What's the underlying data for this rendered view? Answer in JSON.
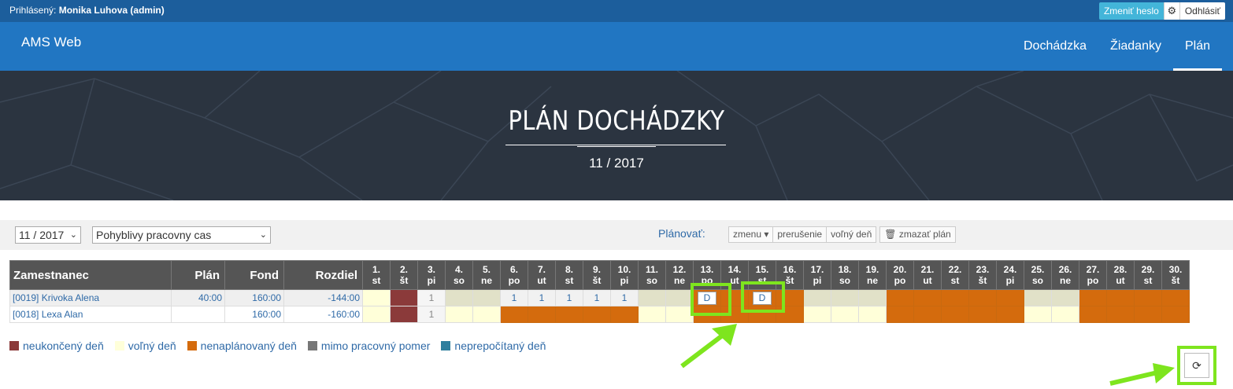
{
  "userbar": {
    "prefix": "Prihlásený:",
    "user": "Monika Luhova (admin)",
    "change_password": "Zmeniť heslo",
    "logout": "Odhlásiť"
  },
  "navbar": {
    "brand": "AMS Web",
    "items": [
      {
        "label": "Dochádzka"
      },
      {
        "label": "Žiadanky"
      },
      {
        "label": "Plán",
        "active": true
      }
    ]
  },
  "hero": {
    "title": "PLÁN DOCHÁDZKY",
    "subtitle": "11 / 2017"
  },
  "toolbar": {
    "month_select": "11 / 2017",
    "schedule_select": "Pohyblivy pracovny cas",
    "plan_label": "Plánovať:",
    "btn_shifts": "zmenu ▾",
    "btn_break": "prerušenie",
    "btn_free_day": "voľný deň",
    "btn_delete_plan": "zmazať plán"
  },
  "table": {
    "headers": {
      "employee": "Zamestnanec",
      "plan": "Plán",
      "fund": "Fond",
      "diff": "Rozdiel"
    },
    "days": [
      {
        "n": "1.",
        "w": "st"
      },
      {
        "n": "2.",
        "w": "št"
      },
      {
        "n": "3.",
        "w": "pi"
      },
      {
        "n": "4.",
        "w": "so"
      },
      {
        "n": "5.",
        "w": "ne"
      },
      {
        "n": "6.",
        "w": "po"
      },
      {
        "n": "7.",
        "w": "ut"
      },
      {
        "n": "8.",
        "w": "st"
      },
      {
        "n": "9.",
        "w": "št"
      },
      {
        "n": "10.",
        "w": "pi"
      },
      {
        "n": "11.",
        "w": "so"
      },
      {
        "n": "12.",
        "w": "ne"
      },
      {
        "n": "13.",
        "w": "po"
      },
      {
        "n": "14.",
        "w": "ut"
      },
      {
        "n": "15.",
        "w": "st"
      },
      {
        "n": "16.",
        "w": "št"
      },
      {
        "n": "17.",
        "w": "pi"
      },
      {
        "n": "18.",
        "w": "so"
      },
      {
        "n": "19.",
        "w": "ne"
      },
      {
        "n": "20.",
        "w": "po"
      },
      {
        "n": "21.",
        "w": "ut"
      },
      {
        "n": "22.",
        "w": "st"
      },
      {
        "n": "23.",
        "w": "št"
      },
      {
        "n": "24.",
        "w": "pi"
      },
      {
        "n": "25.",
        "w": "so"
      },
      {
        "n": "26.",
        "w": "ne"
      },
      {
        "n": "27.",
        "w": "po"
      },
      {
        "n": "28.",
        "w": "ut"
      },
      {
        "n": "29.",
        "w": "st"
      },
      {
        "n": "30.",
        "w": "št"
      }
    ],
    "rows": [
      {
        "name": "[0019] Krivoka Alena",
        "plan": "40:00",
        "fund": "160:00",
        "diff": "-144:00",
        "cells": [
          {
            "s": "w"
          },
          {
            "s": "r"
          },
          {
            "s": "n",
            "t": "1"
          },
          {
            "s": "g"
          },
          {
            "s": "g"
          },
          {
            "s": "l",
            "t": "1"
          },
          {
            "s": "l",
            "t": "1"
          },
          {
            "s": "l",
            "t": "1"
          },
          {
            "s": "l",
            "t": "1"
          },
          {
            "s": "l",
            "t": "1"
          },
          {
            "s": "g"
          },
          {
            "s": "g"
          },
          {
            "s": "o",
            "box": "D"
          },
          {
            "s": "o"
          },
          {
            "s": "o",
            "box": "D"
          },
          {
            "s": "o"
          },
          {
            "s": "g"
          },
          {
            "s": "g"
          },
          {
            "s": "g"
          },
          {
            "s": "o"
          },
          {
            "s": "o"
          },
          {
            "s": "o"
          },
          {
            "s": "o"
          },
          {
            "s": "o"
          },
          {
            "s": "g"
          },
          {
            "s": "g"
          },
          {
            "s": "o"
          },
          {
            "s": "o"
          },
          {
            "s": "o"
          },
          {
            "s": "o"
          }
        ]
      },
      {
        "name": "[0018] Lexa Alan",
        "plan": "",
        "fund": "160:00",
        "diff": "-160:00",
        "cells": [
          {
            "s": "w"
          },
          {
            "s": "r"
          },
          {
            "s": "n",
            "t": "1"
          },
          {
            "s": "w"
          },
          {
            "s": "w"
          },
          {
            "s": "o"
          },
          {
            "s": "o"
          },
          {
            "s": "o"
          },
          {
            "s": "o"
          },
          {
            "s": "o"
          },
          {
            "s": "w"
          },
          {
            "s": "w"
          },
          {
            "s": "o"
          },
          {
            "s": "o"
          },
          {
            "s": "o"
          },
          {
            "s": "o"
          },
          {
            "s": "w"
          },
          {
            "s": "w"
          },
          {
            "s": "w"
          },
          {
            "s": "o"
          },
          {
            "s": "o"
          },
          {
            "s": "o"
          },
          {
            "s": "o"
          },
          {
            "s": "o"
          },
          {
            "s": "w"
          },
          {
            "s": "w"
          },
          {
            "s": "o"
          },
          {
            "s": "o"
          },
          {
            "s": "o"
          },
          {
            "s": "o"
          }
        ]
      }
    ]
  },
  "legend": [
    {
      "label": "neukončený deň",
      "color": "#8b3a3a"
    },
    {
      "label": "voľný deň",
      "color": "#ffffd9"
    },
    {
      "label": "nenaplánovaný deň",
      "color": "#d46b0d"
    },
    {
      "label": "mimo pracovný pomer",
      "color": "#777777"
    },
    {
      "label": "neprepočítaný deň",
      "color": "#2f7f9e"
    }
  ],
  "icons": {
    "settings": "gear-icon",
    "trash": "trash-icon",
    "refresh": "refresh-icon"
  },
  "colors": {
    "topbar": "#1c5e9c",
    "navbar": "#2176c2",
    "highlight": "#7ee51e"
  }
}
